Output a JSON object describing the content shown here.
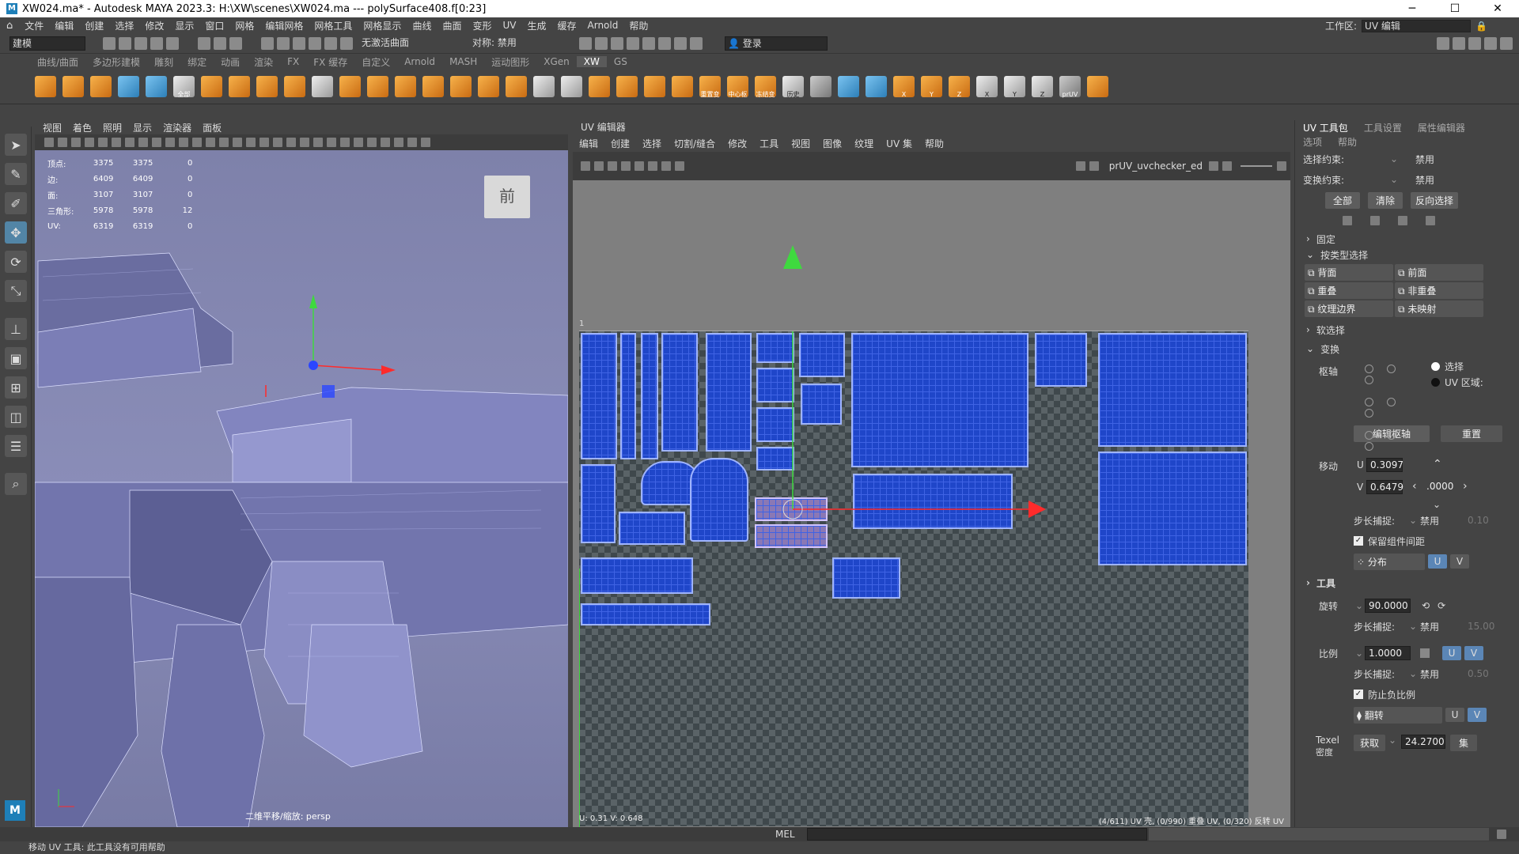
{
  "window": {
    "title": "XW024.ma* - Autodesk MAYA 2023.3: H:\\XW\\scenes\\XW024.ma   ---   polySurface408.f[0:23]"
  },
  "menu": [
    "文件",
    "编辑",
    "创建",
    "选择",
    "修改",
    "显示",
    "窗口",
    "网格",
    "编辑网格",
    "网格工具",
    "网格显示",
    "曲线",
    "曲面",
    "变形",
    "UV",
    "生成",
    "缓存",
    "Arnold",
    "帮助"
  ],
  "workspace": {
    "label": "工作区:",
    "value": "UV 编辑"
  },
  "statusline": {
    "mode": "建模",
    "live_surface": "无激活曲面",
    "symmetry": "对称: 禁用",
    "login": "登录"
  },
  "shelf_tabs": [
    "曲线/曲面",
    "多边形建模",
    "雕刻",
    "绑定",
    "动画",
    "渲染",
    "FX",
    "FX 缓存",
    "自定义",
    "Arnold",
    "MASH",
    "运动图形",
    "XGen",
    "XW",
    "GS"
  ],
  "shelf_active": "XW",
  "shelf_labels": {
    "all": "全部",
    "reset": "重置变",
    "center": "中心枢",
    "freeze": "冻结变",
    "history": "历史",
    "x": "X",
    "y": "Y",
    "z": "Z",
    "x2": "X",
    "y2": "Y",
    "z2": "Z",
    "pruv": "prUV"
  },
  "viewport": {
    "menu": [
      "视图",
      "着色",
      "照明",
      "显示",
      "渲染器",
      "面板"
    ],
    "camera_label": "二维平移/缩放: persp",
    "cube_face": "前"
  },
  "hud": [
    {
      "label": "顶点:",
      "a": "3375",
      "b": "3375",
      "c": "0"
    },
    {
      "label": "边:",
      "a": "6409",
      "b": "6409",
      "c": "0"
    },
    {
      "label": "面:",
      "a": "3107",
      "b": "3107",
      "c": "0"
    },
    {
      "label": "三角形:",
      "a": "5978",
      "b": "5978",
      "c": "12"
    },
    {
      "label": "UV:",
      "a": "6319",
      "b": "6319",
      "c": "0"
    }
  ],
  "uv_editor": {
    "title": "UV 编辑器",
    "menu": [
      "编辑",
      "创建",
      "选择",
      "切割/缝合",
      "修改",
      "工具",
      "视图",
      "图像",
      "纹理",
      "UV 集",
      "帮助"
    ],
    "texture": "prUV_uvchecker_ed",
    "tile_label": "1",
    "coords": "U: 0.31 V: 0.648",
    "status": "(4/611) UV 壳, (0/990) 重叠 UV, (0/320) 反转 UV"
  },
  "right_panel": {
    "tabs": [
      "UV 工具包",
      "工具设置",
      "属性编辑器"
    ],
    "submenu": [
      "选项",
      "帮助"
    ],
    "selection_constraint": {
      "label": "选择约束:",
      "value": "禁用"
    },
    "transform_constraint": {
      "label": "变换约束:",
      "value": "禁用"
    },
    "buttons": {
      "all": "全部",
      "clear": "清除",
      "invert": "反向选择"
    },
    "pin": "固定",
    "select_by_type": "按类型选择",
    "type_buttons": [
      {
        "left": "背面",
        "right": "前面"
      },
      {
        "left": "重叠",
        "right": "非重叠"
      },
      {
        "left": "纹理边界",
        "right": "未映射"
      }
    ],
    "soft_select": "软选择",
    "transform": "变换",
    "pivot": {
      "label": "枢轴",
      "opt1": "选择",
      "opt2": "UV 区域:"
    },
    "edit_pivot": "编辑枢轴",
    "reset": "重置",
    "move": {
      "label": "移动",
      "u_label": "U",
      "u": "0.3097",
      "v_label": "V",
      "v": "0.6479",
      "step": ".0000"
    },
    "step_snap": {
      "label": "步长捕捉:",
      "value": "禁用",
      "num": "0.10"
    },
    "keep_spacing": "保留组件间距",
    "distribute": "分布",
    "u": "U",
    "v": "V",
    "tools": "工具",
    "rotate": {
      "label": "旋转",
      "value": "90.0000"
    },
    "step_snap2": {
      "label": "步长捕捉:",
      "value": "禁用",
      "num": "15.00"
    },
    "scale": {
      "label": "比例",
      "value": "1.0000"
    },
    "step_snap3": {
      "label": "步长捕捉:",
      "value": "禁用",
      "num": "0.50"
    },
    "prevent_negative": "防止负比例",
    "flip": "翻转",
    "texel": {
      "label": "Texel",
      "sub": "密度",
      "get": "获取",
      "value": "24.2700",
      "set": "集"
    }
  },
  "command": {
    "lang": "MEL"
  },
  "help_line": "移动 UV 工具: 此工具没有可用帮助",
  "colors": {
    "uv_shell": "#1f46c9",
    "shell_border": "#9fb4ff",
    "viewport_bg": "#7e81aa",
    "active_tab": "#5a5a5a"
  }
}
